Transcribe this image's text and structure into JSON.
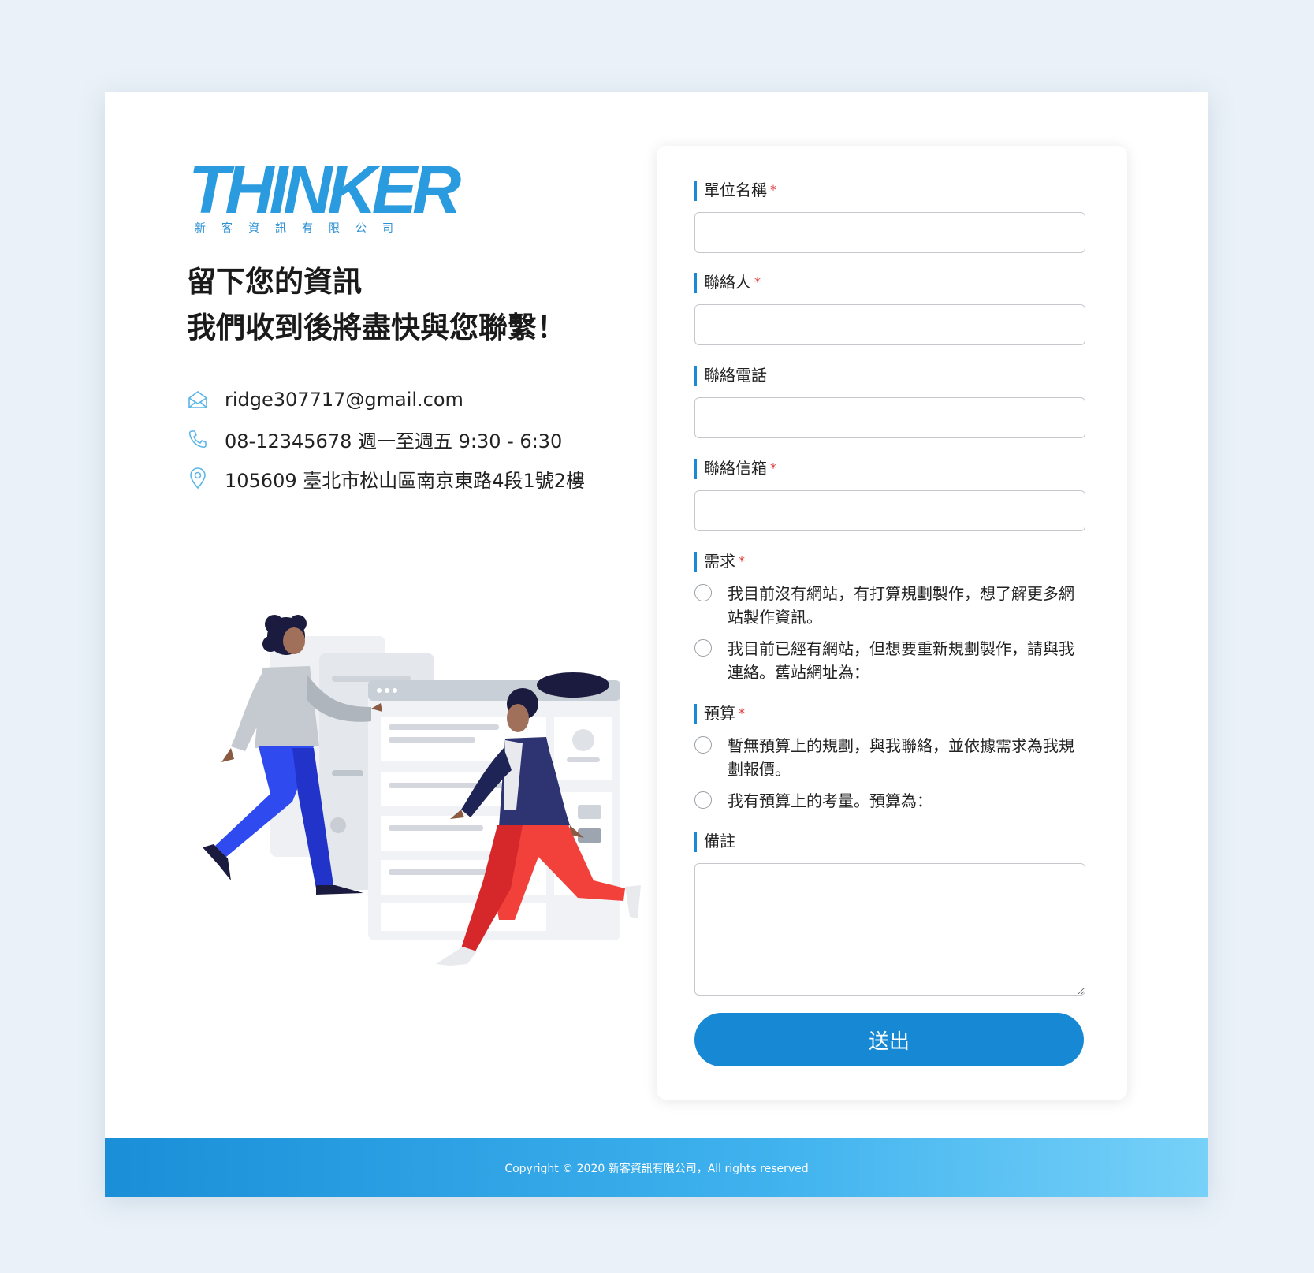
{
  "colors": {
    "accent": "#1789d4",
    "required": "#e03a3a",
    "footer_start": "#1a8fd8",
    "footer_end": "#77d1f8"
  },
  "brand": {
    "logo_text": "THINKER",
    "logo_subtitle": "新客資訊有限公司"
  },
  "headline": {
    "line1": "留下您的資訊",
    "line2": "我們收到後將盡快與您聯繫！"
  },
  "contact": {
    "email": "ridge307717@gmail.com",
    "phone": "08-12345678 週一至週五 9:30 - 6:30",
    "address": "105609  臺北市松山區南京東路4段1號2樓",
    "icons": [
      "mail-icon",
      "phone-icon",
      "location-pin-icon"
    ]
  },
  "form": {
    "company": {
      "label": "單位名稱",
      "required": "*",
      "value": ""
    },
    "contact_person": {
      "label": "聯絡人",
      "required": "*",
      "value": ""
    },
    "phone": {
      "label": "聯絡電話",
      "value": ""
    },
    "email": {
      "label": "聯絡信箱",
      "required": "*",
      "value": ""
    },
    "needs": {
      "label": "需求",
      "required": "*",
      "options": [
        "我目前沒有網站，有打算規劃製作，想了解更多網站製作資訊。",
        "我目前已經有網站，但想要重新規劃製作，請與我連絡。舊站網址為："
      ]
    },
    "budget": {
      "label": "預算",
      "required": "*",
      "options": [
        "暫無預算上的規劃，與我聯絡，並依據需求為我規劃報價。",
        "我有預算上的考量。預算為："
      ]
    },
    "notes": {
      "label": "備註",
      "value": ""
    },
    "submit_label": "送出"
  },
  "footer": {
    "copyright": "Copyright © 2020 新客資訊有限公司，All rights reserved"
  }
}
